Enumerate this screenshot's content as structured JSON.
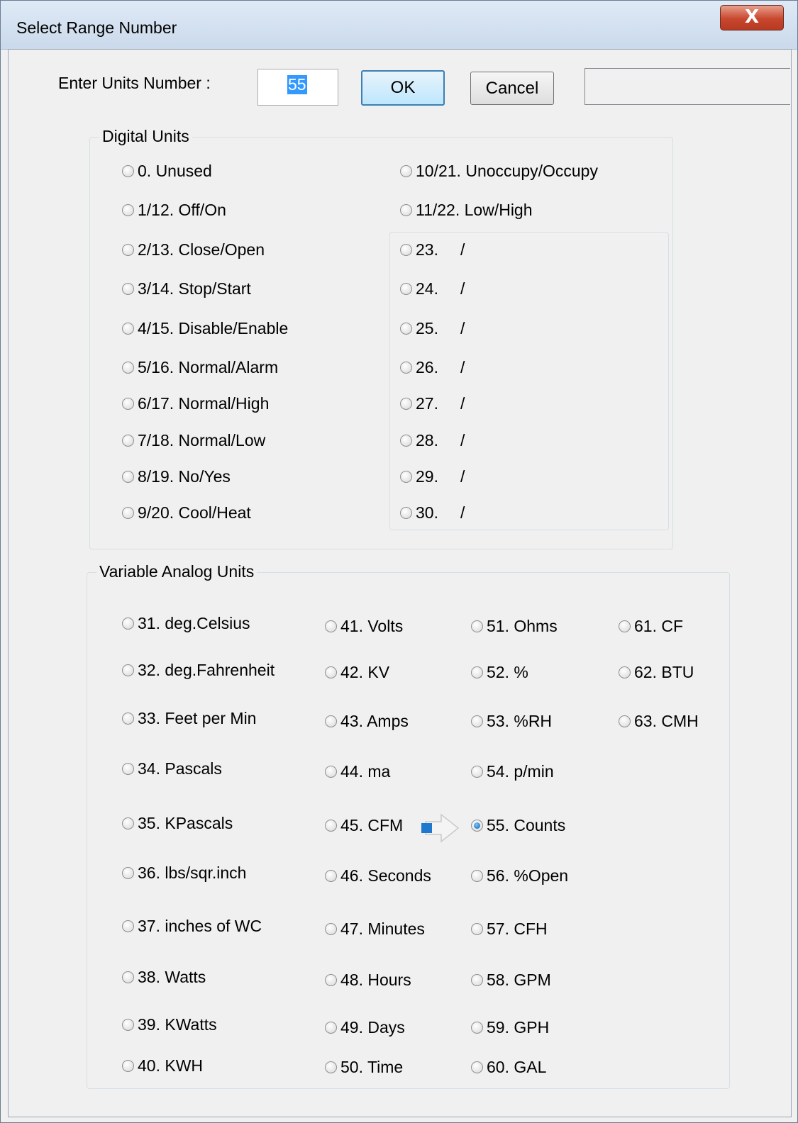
{
  "window": {
    "title": "Select Range Number",
    "close_label": "X"
  },
  "entry": {
    "label": "Enter Units Number :",
    "value": "55",
    "ok_label": "OK",
    "cancel_label": "Cancel",
    "status_text": ""
  },
  "digital": {
    "title": "Digital Units",
    "left": [
      "0. Unused",
      "1/12. Off/On",
      "2/13. Close/Open",
      "3/14. Stop/Start",
      "4/15. Disable/Enable",
      "5/16. Normal/Alarm",
      "6/17. Normal/High",
      "7/18. Normal/Low",
      "8/19. No/Yes",
      "9/20. Cool/Heat"
    ],
    "right_top": [
      "10/21. Unoccupy/Occupy",
      "11/22. Low/High"
    ],
    "custom_numbers": [
      "23.",
      "24.",
      "25.",
      "26.",
      "27.",
      "28.",
      "29.",
      "30."
    ],
    "custom_sep": "/"
  },
  "analog": {
    "title": "Variable Analog Units",
    "col1": [
      "31. deg.Celsius",
      "32. deg.Fahrenheit",
      "33. Feet per Min",
      "34. Pascals",
      "35. KPascals",
      "36. lbs/sqr.inch",
      "37. inches of WC",
      "38. Watts",
      "39. KWatts",
      "40. KWH"
    ],
    "col2": [
      "41. Volts",
      "42. KV",
      "43. Amps",
      "44. ma",
      "45. CFM",
      "46. Seconds",
      "47. Minutes",
      "48. Hours",
      "49. Days",
      "50. Time"
    ],
    "col3": [
      "51. Ohms",
      "52. %",
      "53. %RH",
      "54. p/min",
      "55. Counts",
      "56. %Open",
      "57. CFH",
      "58. GPM",
      "59. GPH",
      "60. GAL"
    ],
    "col4": [
      "61. CF",
      "62. BTU",
      "63. CMH"
    ],
    "selected": "55. Counts"
  }
}
